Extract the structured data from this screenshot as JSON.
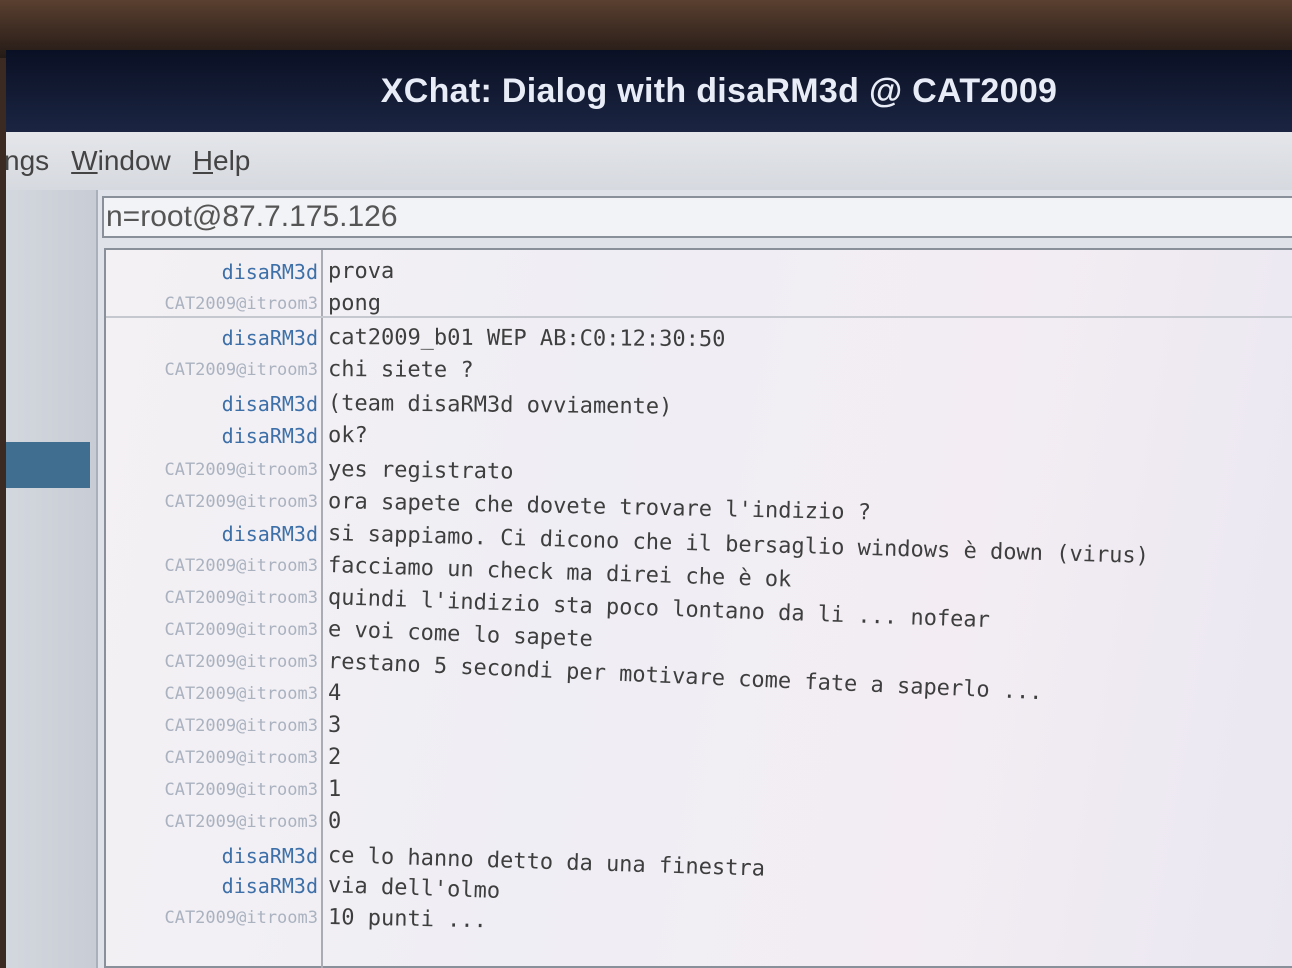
{
  "window": {
    "title": "XChat: Dialog with disaRM3d @ CAT2009"
  },
  "menubar": {
    "items": [
      {
        "pre": "",
        "u": "",
        "post": "ngs"
      },
      {
        "pre": "",
        "u": "W",
        "post": "indow"
      },
      {
        "pre": "",
        "u": "H",
        "post": "elp"
      }
    ]
  },
  "topic": {
    "text": "n=root@87.7.175.126"
  },
  "chat": {
    "messages": [
      {
        "nick": "disaRM3d",
        "kind": "me",
        "text": "prova"
      },
      {
        "nick": "CAT2009@itroom3",
        "kind": "them",
        "text": "pong"
      },
      {
        "nick": "disaRM3d",
        "kind": "me",
        "text": " cat2009_b01 WEP AB:C0:12:30:50"
      },
      {
        "nick": "CAT2009@itroom3",
        "kind": "them",
        "text": "chi siete ?"
      },
      {
        "nick": "disaRM3d",
        "kind": "me",
        "text": "(team disaRM3d ovviamente)"
      },
      {
        "nick": "disaRM3d",
        "kind": "me",
        "text": "ok?"
      },
      {
        "nick": "CAT2009@itroom3",
        "kind": "them",
        "text": "yes registrato"
      },
      {
        "nick": "CAT2009@itroom3",
        "kind": "them",
        "text": "ora sapete che dovete trovare l'indizio ?"
      },
      {
        "nick": "disaRM3d",
        "kind": "me",
        "text": "si sappiamo. Ci dicono che il bersaglio windows è down (virus)"
      },
      {
        "nick": "CAT2009@itroom3",
        "kind": "them",
        "text": "facciamo un check ma direi che è ok"
      },
      {
        "nick": "CAT2009@itroom3",
        "kind": "them",
        "text": "quindi l'indizio sta poco lontano da li ... nofear"
      },
      {
        "nick": "CAT2009@itroom3",
        "kind": "them",
        "text": "e voi come lo sapete"
      },
      {
        "nick": "CAT2009@itroom3",
        "kind": "them",
        "text": "restano 5 secondi per motivare come fate a saperlo ..."
      },
      {
        "nick": "CAT2009@itroom3",
        "kind": "them",
        "text": "4"
      },
      {
        "nick": "CAT2009@itroom3",
        "kind": "them",
        "text": "3"
      },
      {
        "nick": "CAT2009@itroom3",
        "kind": "them",
        "text": "2"
      },
      {
        "nick": "CAT2009@itroom3",
        "kind": "them",
        "text": "1"
      },
      {
        "nick": "CAT2009@itroom3",
        "kind": "them",
        "text": "0"
      },
      {
        "nick": "disaRM3d",
        "kind": "me",
        "text": "ce lo hanno detto da una finestra"
      },
      {
        "nick": "disaRM3d",
        "kind": "me",
        "text": "via dell'olmo"
      },
      {
        "nick": "CAT2009@itroom3",
        "kind": "them",
        "text": " 10 punti ..."
      }
    ]
  }
}
